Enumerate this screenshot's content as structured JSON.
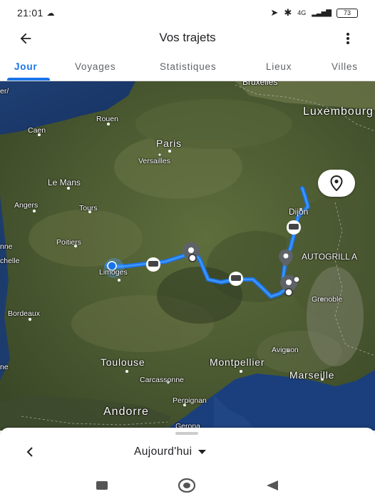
{
  "status_bar": {
    "time": "21:01",
    "cloud_icon": "cloud-icon",
    "signal_text": "4G",
    "battery": "73"
  },
  "app_bar": {
    "title": "Vos trajets",
    "back_icon": "arrow-back-icon",
    "more_icon": "more-vert-icon"
  },
  "tabs": [
    "Jour",
    "Voyages",
    "Statistiques",
    "Lieux",
    "Villes"
  ],
  "active_tab": "Jour",
  "map": {
    "labels": {
      "bruxelles_partial": "Bruxelles",
      "luxembourg": "Luxembourg",
      "rouen": "Rouen",
      "caen": "Caen",
      "paris": "Paris",
      "versailles": "Versailles",
      "le_mans": "Le Mans",
      "angers": "Angers",
      "tours": "Tours",
      "poitiers": "Poitiers",
      "nantes_partial": "nne",
      "la_rochelle_partial": "chelle",
      "limoges": "Limoges",
      "dijon": "Dijon",
      "autogrill": "AUTOGRILL A",
      "grenoble": "Grenoble",
      "bordeaux": "Bordeaux",
      "avignon": "Avignon",
      "toulouse": "Toulouse",
      "montpellier": "Montpellier",
      "marseille": "Marseille",
      "carcassonne": "Carcassonne",
      "perpignan": "Perpignan",
      "andorre": "Andorre",
      "gerona": "Gerona",
      "left_edge_ne": "ne",
      "top_left_partial": "er/"
    },
    "route_color": "#1a73e8",
    "location_button_icon": "map-pin-icon"
  },
  "sheet": {
    "prev_icon": "chevron-left-icon",
    "date_label": "Aujourd'hui",
    "dropdown_icon": "dropdown-arrow-icon"
  },
  "nav_bar": {
    "recents_icon": "square-icon",
    "home_icon": "circle-icon",
    "back_icon": "triangle-back-icon"
  }
}
